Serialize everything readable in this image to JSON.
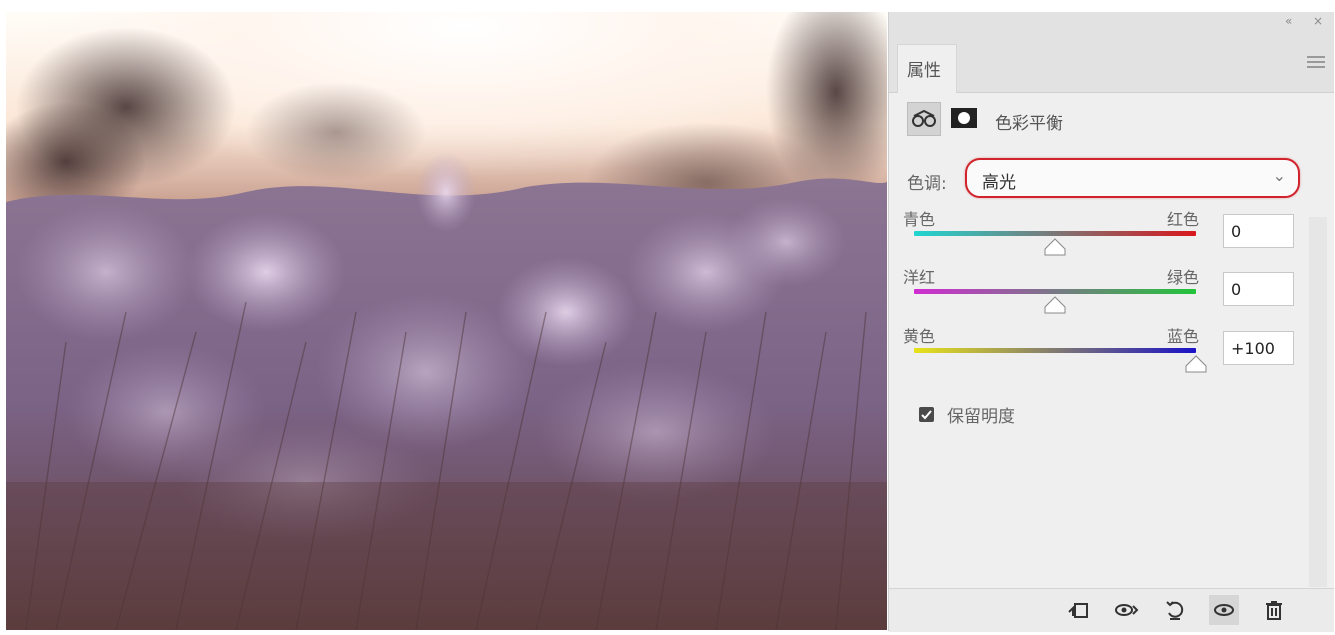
{
  "panel": {
    "window_controls": {
      "collapse": "«",
      "close": "×"
    },
    "tab": {
      "label": "属性"
    },
    "adjustment": {
      "title": "色彩平衡"
    },
    "tone": {
      "label": "色调:",
      "value": "高光"
    },
    "sliders": [
      {
        "left": "青色",
        "right": "红色",
        "value": "0",
        "position": 0.5
      },
      {
        "left": "洋红",
        "right": "绿色",
        "value": "0",
        "position": 0.5
      },
      {
        "left": "黄色",
        "right": "蓝色",
        "value": "+100",
        "position": 1.0
      }
    ],
    "preserve": {
      "label": "保留明度",
      "checked": true
    },
    "footer": {
      "buttons": [
        "clip-to-layer-icon",
        "view-previous-state-icon",
        "reset-icon",
        "visibility-eye-icon",
        "trash-icon"
      ]
    }
  },
  "colors": {
    "highlight_ring": "#d0232c",
    "cyan_red": [
      "#1fd6d0",
      "#d9171d"
    ],
    "magenta_green": [
      "#d02cd2",
      "#22c53a"
    ],
    "yellow_blue": [
      "#e8e21a",
      "#1a12c8"
    ]
  }
}
